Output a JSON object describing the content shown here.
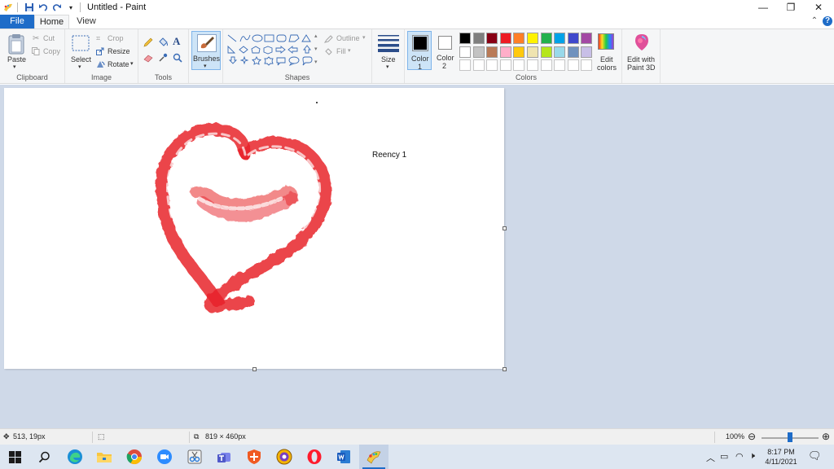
{
  "window": {
    "title": "Untitled - Paint",
    "minimize_glyph": "—",
    "maximize_glyph": "❐",
    "close_glyph": "✕"
  },
  "tabs": {
    "file": "File",
    "home": "Home",
    "view": "View",
    "collapse_glyph": "⌃",
    "help_glyph": "?"
  },
  "ribbon": {
    "clipboard": {
      "paste": "Paste",
      "cut": "Cut",
      "copy": "Copy",
      "label": "Clipboard"
    },
    "image": {
      "select": "Select",
      "crop": "Crop",
      "resize": "Resize",
      "rotate": "Rotate",
      "label": "Image"
    },
    "tools": {
      "label": "Tools",
      "text_glyph": "A"
    },
    "brushes": {
      "label": "Brushes"
    },
    "shapes": {
      "outline": "Outline",
      "fill": "Fill",
      "label": "Shapes"
    },
    "size": {
      "label": "Size"
    },
    "color1": {
      "line1": "Color",
      "line2": "1",
      "value": "#000000"
    },
    "color2": {
      "line1": "Color",
      "line2": "2",
      "value": "#ffffff"
    },
    "colors": {
      "label": "Colors",
      "row1": [
        "#000000",
        "#7f7f7f",
        "#880015",
        "#ed1c24",
        "#ff7f27",
        "#fff200",
        "#22b14c",
        "#00a2e8",
        "#3f48cc",
        "#a349a4"
      ],
      "row2": [
        "#ffffff",
        "#c3c3c3",
        "#b97a57",
        "#ffaec9",
        "#ffc90e",
        "#efe4b0",
        "#b5e61d",
        "#99d9ea",
        "#7092be",
        "#c8bfe7"
      ],
      "edit_line1": "Edit",
      "edit_line2": "colors"
    },
    "paint3d": {
      "line1": "Edit with",
      "line2": "Paint 3D"
    }
  },
  "canvas": {
    "text": "Reency 1",
    "heart_color": "#e8242c"
  },
  "status": {
    "cursor_pos": "513, 19px",
    "image_size": "819 × 460px",
    "zoom": "100%",
    "zoom_level_percent": 100
  },
  "taskbar": {
    "time": "8:17 PM",
    "date": "4/11/2021"
  }
}
